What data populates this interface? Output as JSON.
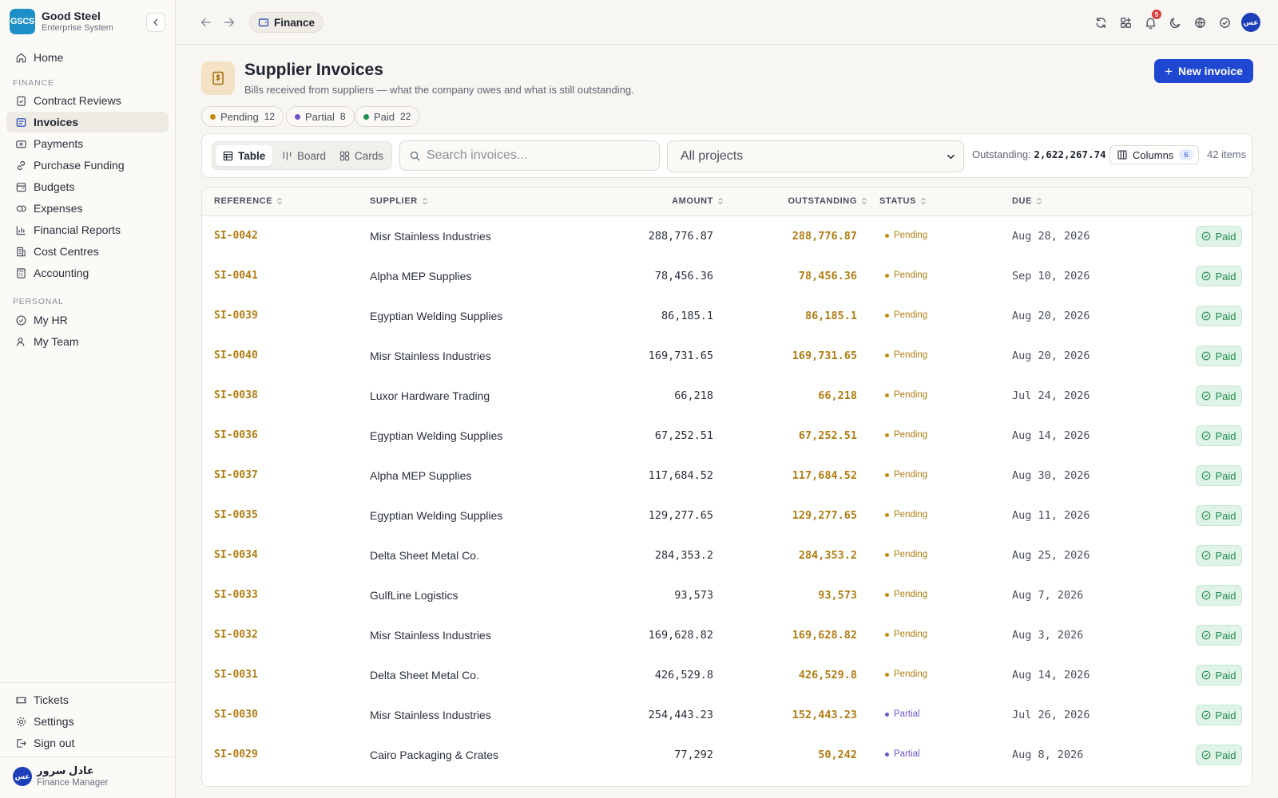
{
  "app": {
    "name": "Good Steel",
    "subtitle": "Enterprise System",
    "logo_text": "GSCS"
  },
  "sidebar": {
    "home": "Home",
    "section_finance": "FINANCE",
    "finance_items": [
      {
        "label": "Contract Reviews",
        "icon": "clipboard-check-icon"
      },
      {
        "label": "Invoices",
        "icon": "file-invoice-icon",
        "active": true
      },
      {
        "label": "Payments",
        "icon": "wallet-icon"
      },
      {
        "label": "Purchase Funding",
        "icon": "link-icon"
      },
      {
        "label": "Budgets",
        "icon": "budget-icon"
      },
      {
        "label": "Expenses",
        "icon": "coins-icon"
      },
      {
        "label": "Financial Reports",
        "icon": "bar-chart-icon"
      },
      {
        "label": "Cost Centres",
        "icon": "building-icon"
      },
      {
        "label": "Accounting",
        "icon": "calculator-icon"
      }
    ],
    "section_personal": "PERSONAL",
    "personal_items": [
      {
        "label": "My HR",
        "icon": "check-circle-icon"
      },
      {
        "label": "My Team",
        "icon": "users-icon"
      }
    ],
    "bottom_items": [
      {
        "label": "Tickets",
        "icon": "ticket-icon"
      },
      {
        "label": "Settings",
        "icon": "gear-icon"
      },
      {
        "label": "Sign out",
        "icon": "sign-out-icon"
      }
    ],
    "user": {
      "name": "عادل سرور",
      "role": "Finance Manager",
      "initials": "عس"
    }
  },
  "topbar": {
    "breadcrumb": "Finance",
    "notifications": "5",
    "avatar_initials": "عس"
  },
  "page": {
    "title": "Supplier Invoices",
    "subtitle": "Bills received from suppliers — what the company owes and what is still outstanding.",
    "new_button": "New invoice"
  },
  "filters": {
    "chips": [
      {
        "label": "Pending",
        "count": "12",
        "color": "#c38a12"
      },
      {
        "label": "Partial",
        "count": "8",
        "color": "#6f52c6"
      },
      {
        "label": "Paid",
        "count": "22",
        "color": "#1f8a4c"
      }
    ]
  },
  "toolbar": {
    "views": [
      "Table",
      "Board",
      "Cards"
    ],
    "active_view": "Table",
    "search_placeholder": "Search invoices...",
    "project_select": "All projects",
    "outstanding_label": "Outstanding:",
    "outstanding_value": "2,622,267.74",
    "columns_label": "Columns",
    "columns_count": "6",
    "items_count": "42 items"
  },
  "table": {
    "headers": [
      "REFERENCE",
      "SUPPLIER",
      "AMOUNT",
      "OUTSTANDING",
      "STATUS",
      "DUE"
    ],
    "action_label": "Paid",
    "rows": [
      {
        "ref": "SI-0042",
        "supplier": "Misr Stainless Industries",
        "amount": "288,776.87",
        "outstanding": "288,776.87",
        "status": "Pending",
        "due": "Aug 28, 2026"
      },
      {
        "ref": "SI-0041",
        "supplier": "Alpha MEP Supplies",
        "amount": "78,456.36",
        "outstanding": "78,456.36",
        "status": "Pending",
        "due": "Sep 10, 2026"
      },
      {
        "ref": "SI-0039",
        "supplier": "Egyptian Welding Supplies",
        "amount": "86,185.1",
        "outstanding": "86,185.1",
        "status": "Pending",
        "due": "Aug 20, 2026"
      },
      {
        "ref": "SI-0040",
        "supplier": "Misr Stainless Industries",
        "amount": "169,731.65",
        "outstanding": "169,731.65",
        "status": "Pending",
        "due": "Aug 20, 2026"
      },
      {
        "ref": "SI-0038",
        "supplier": "Luxor Hardware Trading",
        "amount": "66,218",
        "outstanding": "66,218",
        "status": "Pending",
        "due": "Jul 24, 2026"
      },
      {
        "ref": "SI-0036",
        "supplier": "Egyptian Welding Supplies",
        "amount": "67,252.51",
        "outstanding": "67,252.51",
        "status": "Pending",
        "due": "Aug 14, 2026"
      },
      {
        "ref": "SI-0037",
        "supplier": "Alpha MEP Supplies",
        "amount": "117,684.52",
        "outstanding": "117,684.52",
        "status": "Pending",
        "due": "Aug 30, 2026"
      },
      {
        "ref": "SI-0035",
        "supplier": "Egyptian Welding Supplies",
        "amount": "129,277.65",
        "outstanding": "129,277.65",
        "status": "Pending",
        "due": "Aug 11, 2026"
      },
      {
        "ref": "SI-0034",
        "supplier": "Delta Sheet Metal Co.",
        "amount": "284,353.2",
        "outstanding": "284,353.2",
        "status": "Pending",
        "due": "Aug 25, 2026"
      },
      {
        "ref": "SI-0033",
        "supplier": "GulfLine Logistics",
        "amount": "93,573",
        "outstanding": "93,573",
        "status": "Pending",
        "due": "Aug 7, 2026"
      },
      {
        "ref": "SI-0032",
        "supplier": "Misr Stainless Industries",
        "amount": "169,628.82",
        "outstanding": "169,628.82",
        "status": "Pending",
        "due": "Aug 3, 2026"
      },
      {
        "ref": "SI-0031",
        "supplier": "Delta Sheet Metal Co.",
        "amount": "426,529.8",
        "outstanding": "426,529.8",
        "status": "Pending",
        "due": "Aug 14, 2026"
      },
      {
        "ref": "SI-0030",
        "supplier": "Misr Stainless Industries",
        "amount": "254,443.23",
        "outstanding": "152,443.23",
        "status": "Partial",
        "due": "Jul 26, 2026"
      },
      {
        "ref": "SI-0029",
        "supplier": "Cairo Packaging & Crates",
        "amount": "77,292",
        "outstanding": "50,242",
        "status": "Partial",
        "due": "Aug 8, 2026"
      }
    ]
  },
  "colors": {
    "accent": "#1f47d1",
    "pending": "#b07d14",
    "partial": "#6f52c6",
    "paid": "#1f8a4c",
    "brand": "#1e90c8"
  }
}
